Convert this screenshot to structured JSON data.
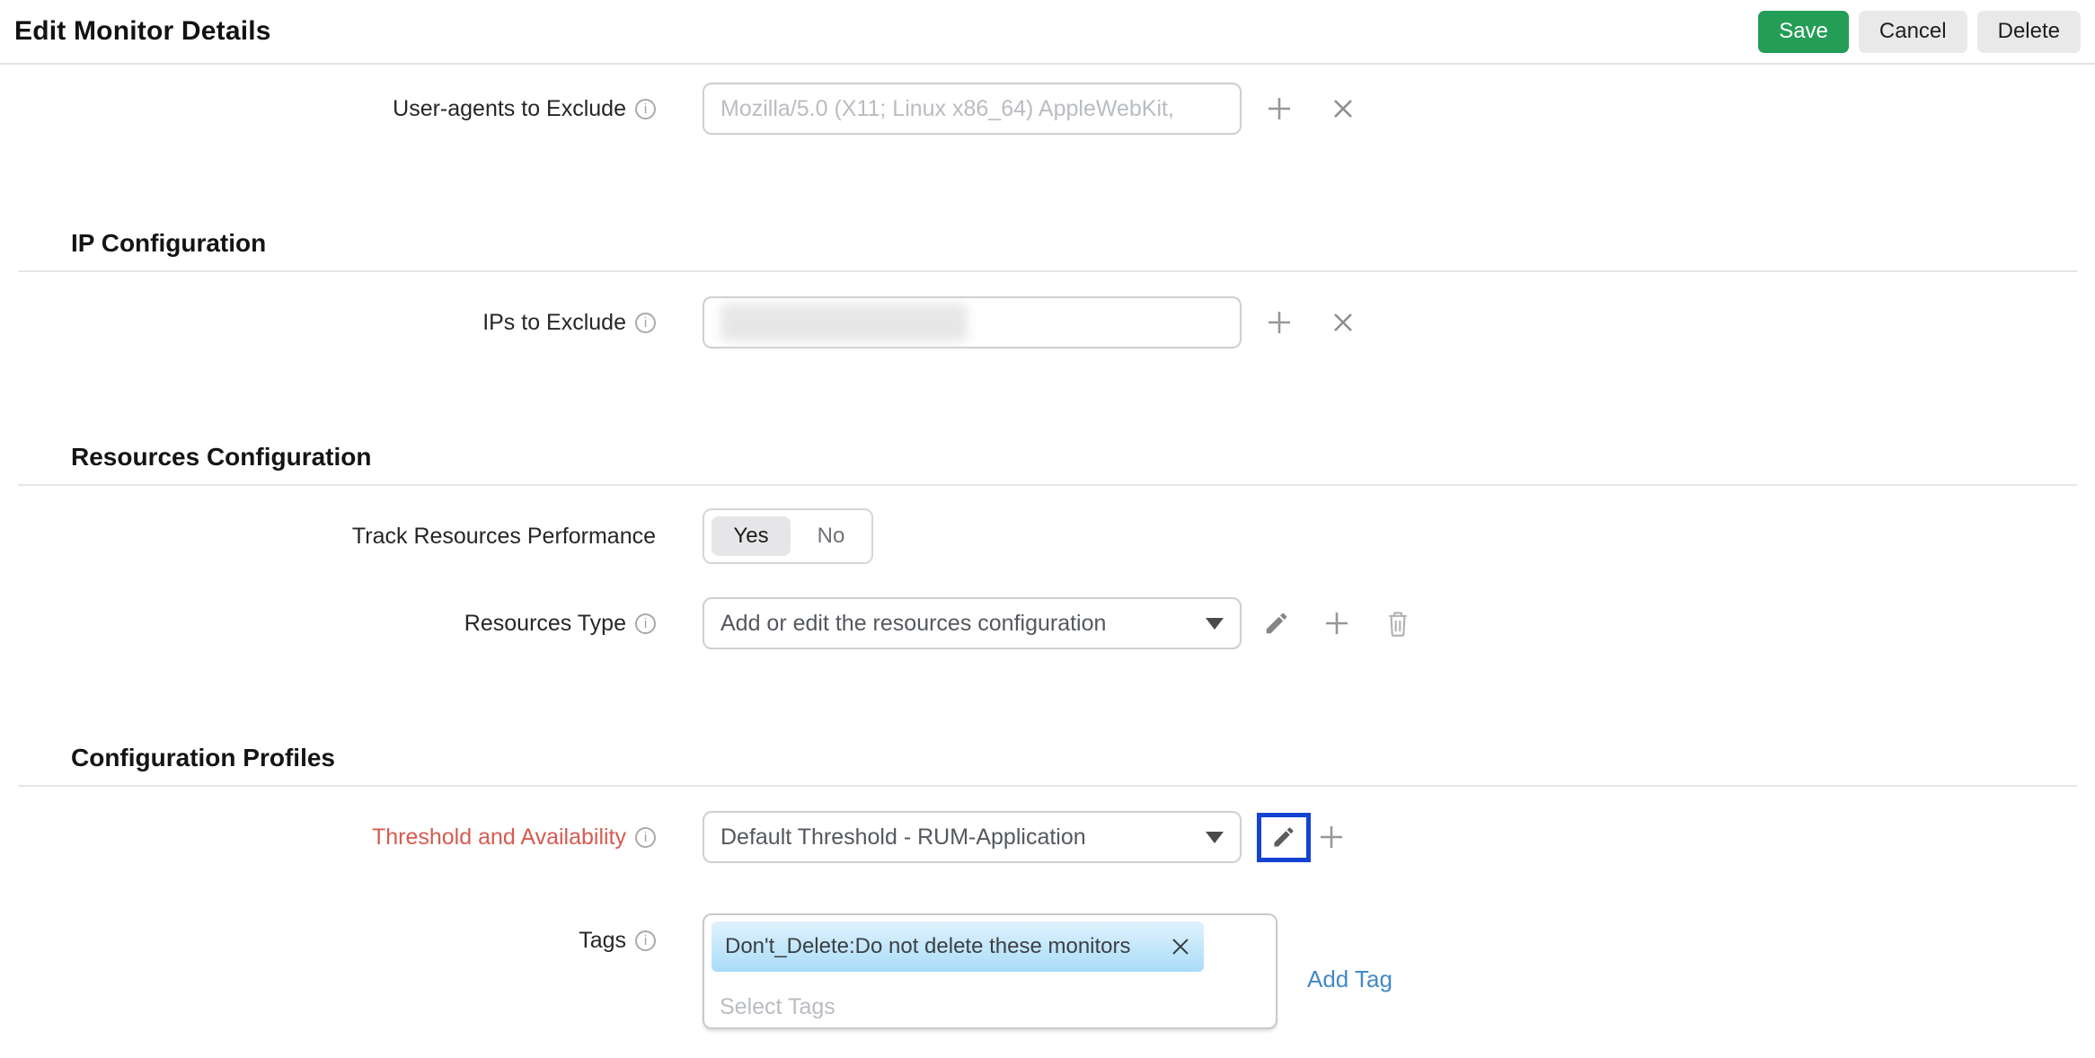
{
  "title": "Edit Monitor Details",
  "toolbar": {
    "save": "Save",
    "cancel": "Cancel",
    "delete": "Delete"
  },
  "sections": {
    "ip": "IP Configuration",
    "resources": "Resources Configuration",
    "profiles": "Configuration Profiles"
  },
  "fields": {
    "user_agents": {
      "label": "User-agents to Exclude",
      "placeholder": "Mozilla/5.0 (X11; Linux x86_64) AppleWebKit,"
    },
    "ips": {
      "label": "IPs to Exclude",
      "value_redacted": true
    },
    "track_resources": {
      "label": "Track Resources Performance",
      "options": [
        "Yes",
        "No"
      ],
      "selected": "Yes"
    },
    "resources_type": {
      "label": "Resources Type",
      "selected": "Add or edit the resources configuration"
    },
    "threshold": {
      "label": "Threshold and Availability",
      "selected": "Default Threshold - RUM-Application"
    },
    "tags": {
      "label": "Tags",
      "chips": [
        "Don't_Delete:Do not delete these monitors"
      ],
      "placeholder": "Select Tags",
      "add_link": "Add Tag"
    }
  },
  "colors": {
    "save_green": "#249d57",
    "button_gray": "#e9e9ea",
    "link_blue": "#4289ca",
    "threshold_label_red": "#d65b51",
    "focus_ring_blue": "#1443d3",
    "chip_gradient_top": "#e0f2fd",
    "chip_gradient_bottom": "#a9dcf8",
    "divider_gray": "#e6e6e6"
  }
}
